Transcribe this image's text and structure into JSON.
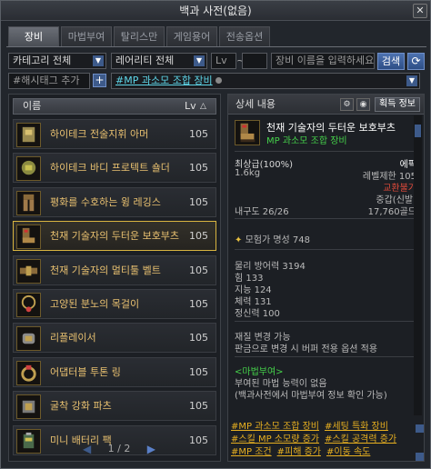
{
  "window": {
    "title": "백과 사전(없음)",
    "close": "✕"
  },
  "tabs": [
    {
      "label": "장비",
      "active": true
    },
    {
      "label": "마법부여",
      "active": false
    },
    {
      "label": "탈리스만",
      "active": false
    },
    {
      "label": "게임용어",
      "active": false
    },
    {
      "label": "전송옵션",
      "active": false
    }
  ],
  "filters": {
    "category": "카테고리 전체",
    "rarity": "레어리티 전체",
    "level_min": "Lv",
    "level_tilde": "~",
    "level_max": "",
    "search_placeholder": "장비 이름을 입력하세요.",
    "search_button": "검색",
    "refresh_icon": "⟳"
  },
  "hashtag": {
    "label": "#해시태그 추가",
    "add": "+",
    "selected": "#MP 과소모 조합 장비"
  },
  "list": {
    "col_name": "이름",
    "col_lv": "Lv",
    "sort_icon": "△",
    "items": [
      {
        "name": "하이테크 전술지휘 아머",
        "lv": "105",
        "icon": "armor-icon"
      },
      {
        "name": "하이테크 바디 프로텍트 숄더",
        "lv": "105",
        "icon": "shoulder-icon"
      },
      {
        "name": "평화를 수호하는 윙 레깅스",
        "lv": "105",
        "icon": "leggings-icon"
      },
      {
        "name": "천재 기술자의 두터운 보호부츠",
        "lv": "105",
        "icon": "boots-icon",
        "active": true
      },
      {
        "name": "천재 기술자의 멀티툴 벨트",
        "lv": "105",
        "icon": "belt-icon"
      },
      {
        "name": "고양된 분노의 목걸이",
        "lv": "105",
        "icon": "necklace-icon"
      },
      {
        "name": "리플레이서",
        "lv": "105",
        "icon": "bracelet-icon"
      },
      {
        "name": "어댑터블 투톤 링",
        "lv": "105",
        "icon": "ring-icon"
      },
      {
        "name": "굴착 강화 파츠",
        "lv": "105",
        "icon": "parts-icon"
      },
      {
        "name": "미니 배터리 팩",
        "lv": "105",
        "icon": "battery-icon"
      }
    ],
    "page": "1 / 2",
    "prev": "◀",
    "next": "▶"
  },
  "detail": {
    "header": "상세 내용",
    "gear_icon": "⚙",
    "eye_icon": "◉",
    "acquire_button": "획득 정보",
    "item_name": "천재 기술자의 두터운 보호부츠",
    "item_tag": "MP 과소모 조합 장비",
    "grade": "최상급(100%)",
    "rarity": "에픽",
    "weight": "1.6kg",
    "level_limit": "레벨제한 105",
    "trade": "교환불가",
    "armor_type": "중갑(신발)",
    "durability": "내구도 26/26",
    "price": "17,760골드",
    "fame": "모험가 명성 748",
    "stats": [
      "물리 방어력 3194",
      "힘 133",
      "지능 124",
      "체력 131",
      "정신력 100"
    ],
    "note1": "재질 변경 가능",
    "note2": "판금으로 변경 시 버퍼 전용 옵션 적용",
    "ench_title": "<마법부여>",
    "ench1": "부여된 마법 능력이 없음",
    "ench2": "(백과사전에서 마법부여 정보 확인 가능)",
    "tags": [
      "#MP 과소모 조합 장비",
      "#세팅 특화 장비",
      "#스킬 MP 소모량 증가",
      "#스킬 공격력 증가",
      "#MP 조건",
      "#피해 증가",
      "#이동 속도"
    ]
  },
  "colors": {
    "accent": "#3d5a8a",
    "legendary_name": "#e8c070",
    "epic": "#ffffff",
    "tag_green": "#45d04a",
    "untradable": "#e04a3a",
    "tag_orange": "#e8b020"
  }
}
